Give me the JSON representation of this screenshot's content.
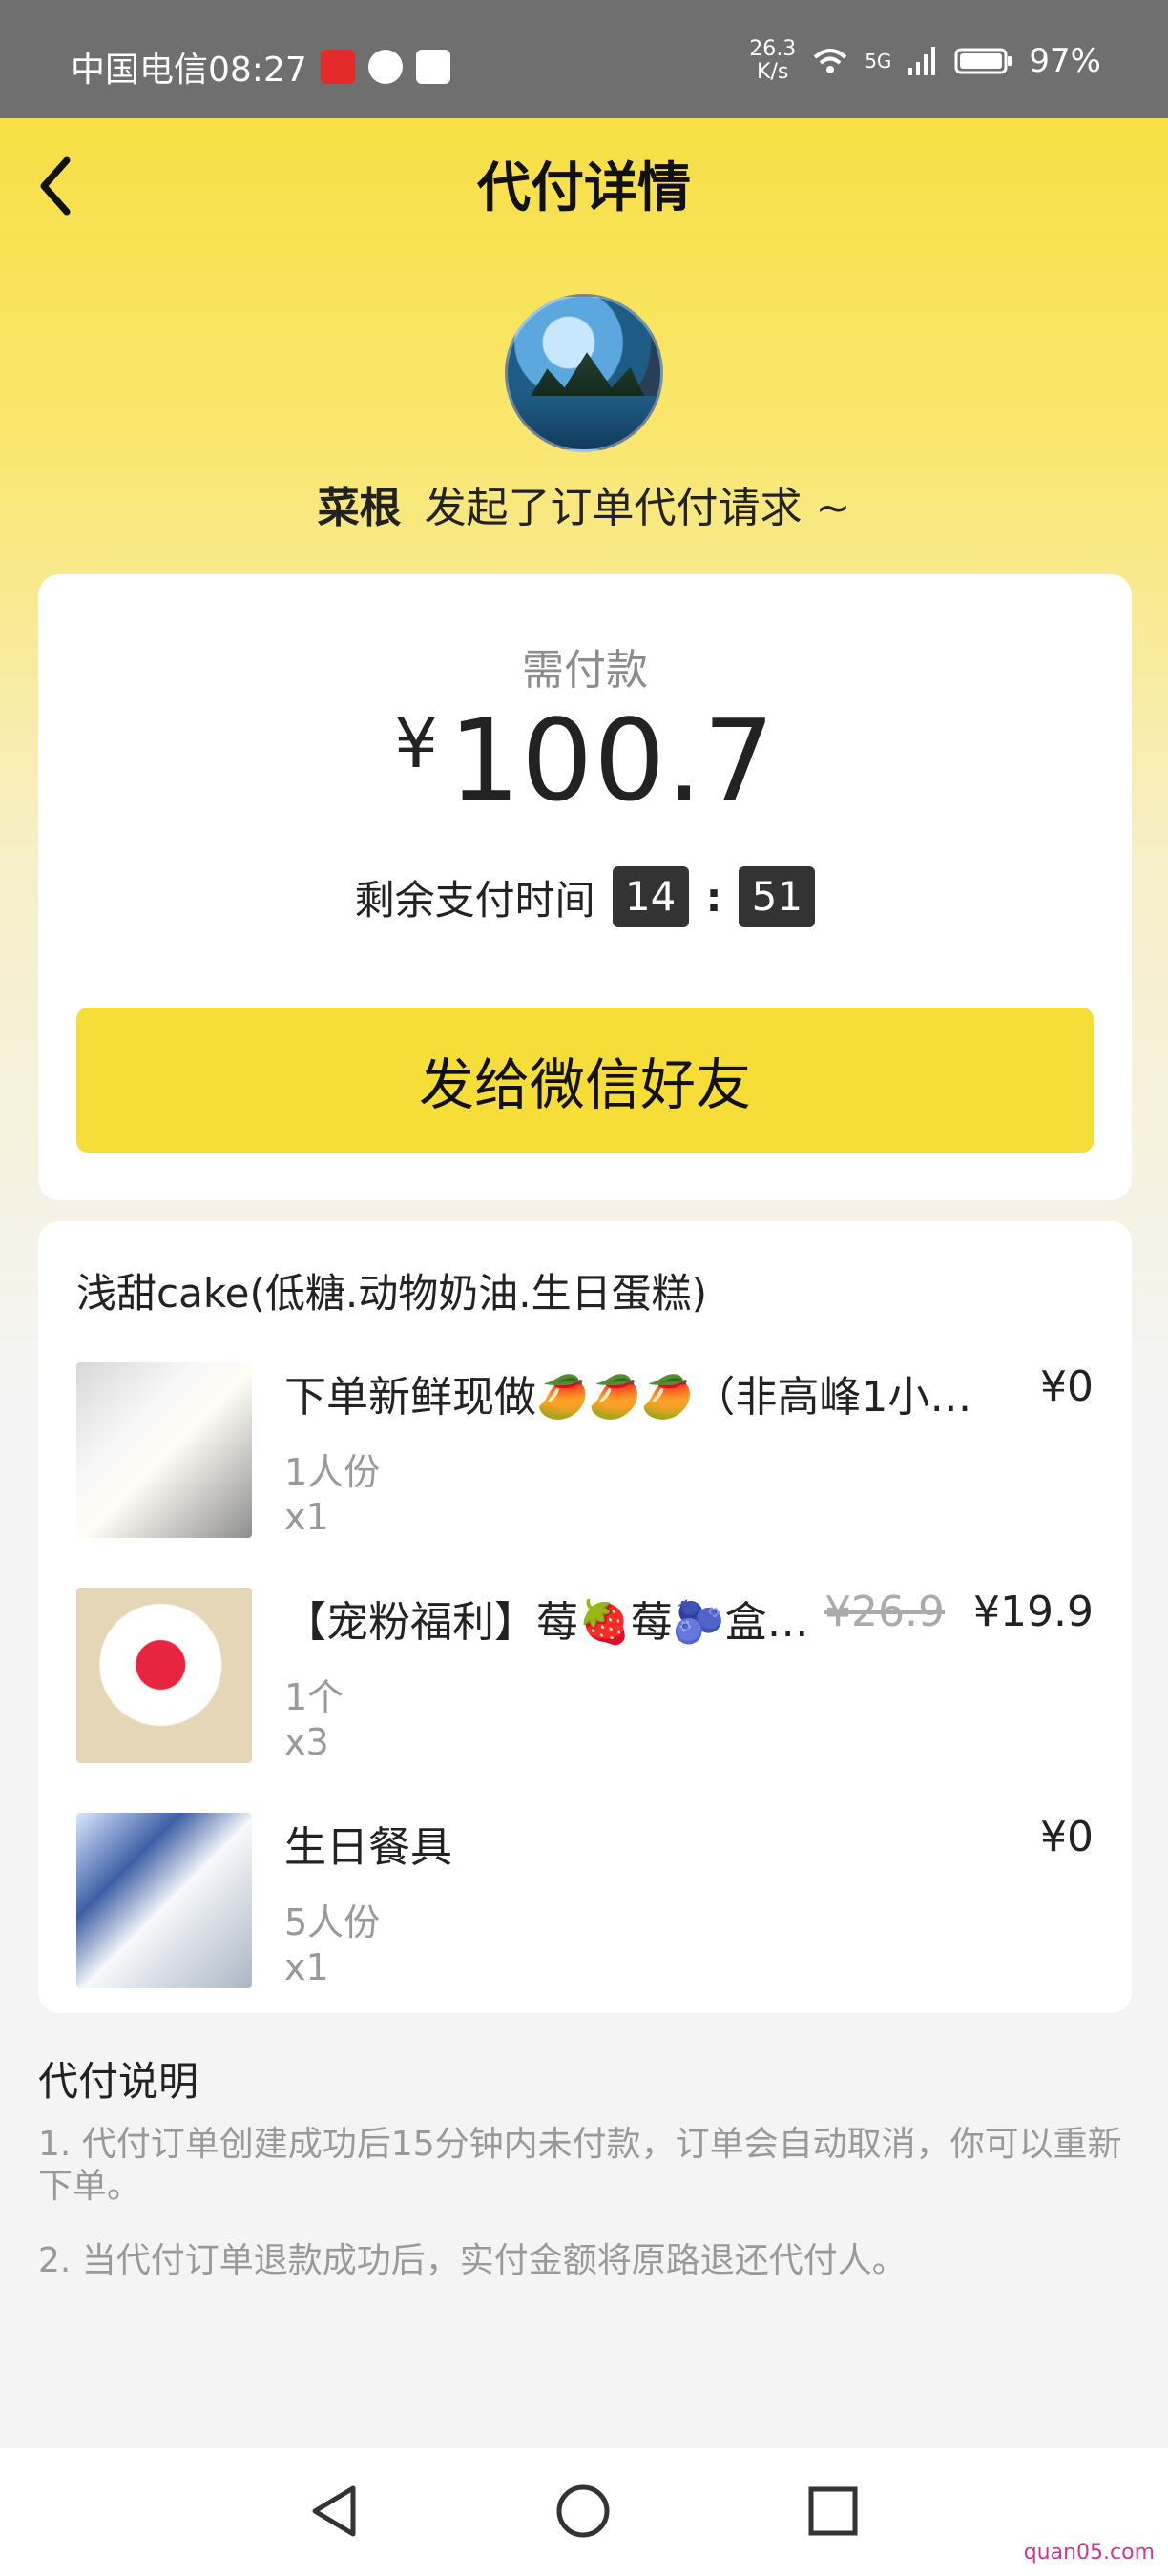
{
  "status_bar": {
    "carrier_time": "中国电信08:27",
    "speed_value": "26.3",
    "speed_unit": "K/s",
    "network": "5G",
    "battery": "97%"
  },
  "header": {
    "title": "代付详情"
  },
  "requester": {
    "name": "菜根",
    "message": "发起了订单代付请求 ~"
  },
  "payment": {
    "label": "需付款",
    "currency": "¥",
    "amount": "100.7",
    "timer_label": "剩余支付时间",
    "minutes": "14",
    "separator": ":",
    "seconds": "51",
    "button_label": "发给微信好友"
  },
  "order": {
    "shop_name": "浅甜cake(低糖.动物奶油.生日蛋糕)",
    "items": [
      {
        "title": "下单新鲜现做🥭🥭🥭（非高峰1小…",
        "spec": "1人份",
        "qty": "x1",
        "price": "¥0"
      },
      {
        "title": "【宠粉福利】莓🍓莓🫐盒…",
        "spec": "1个",
        "qty": "x3",
        "old_price": "¥26.9",
        "price": "¥19.9"
      },
      {
        "title": "生日餐具",
        "spec": "5人份",
        "qty": "x1",
        "price": "¥0"
      }
    ]
  },
  "notes": {
    "title": "代付说明",
    "items": [
      "1. 代付订单创建成功后15分钟内未付款，订单会自动取消，你可以重新下单。",
      "2. 当代付订单退款成功后，实付金额将原路退还代付人。"
    ]
  },
  "watermark": "quan05.com",
  "colors": {
    "accent": "#f7dd37",
    "status_bar": "#6f6f6f",
    "timer_box": "#333333"
  }
}
